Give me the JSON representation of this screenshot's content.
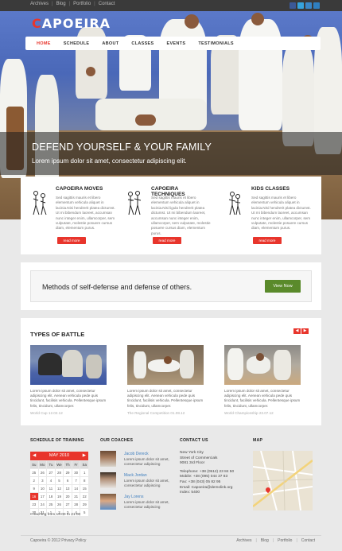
{
  "top_links": [
    "Archives",
    "Blog",
    "Portfolio",
    "Contact"
  ],
  "social": [
    {
      "icon": "facebook-icon",
      "color": "#3b5998"
    },
    {
      "icon": "twitter-icon",
      "color": "#36a3dd"
    },
    {
      "icon": "rss-icon",
      "color": "#3a87c7"
    },
    {
      "icon": "share-icon",
      "color": "#2f7fbf"
    }
  ],
  "logo": {
    "accent": "C",
    "rest": "APOEIRA"
  },
  "nav": [
    "HOME",
    "SCHEDULE",
    "ABOUT",
    "CLASSES",
    "EVENTS",
    "TESTIMONIALS"
  ],
  "hero": {
    "title": "DEFEND YOURSELF & YOUR FAMILY",
    "subtitle": "Lorem ipsum dolor sit amet, consectetur adipiscing elit."
  },
  "features": [
    {
      "title": "CAPOEIRA MOVES",
      "text": "Sed sagittis mauris et libero elementum vehicula aliquet in lacinia.Nisi hendrerit platea dictumst. Ut mi bibendum laoreet, accumsan nunc integer enim, ullamcorper, sem vulputate, molestie posuere cursus diam, elementum purus.",
      "button": "read more"
    },
    {
      "title": "CAPOEIRA TECHNIQUES",
      "text": "Sed sagittis mauris et libero elementum vehicula aliquet in lacinia.Nisi ligula hendrerit platea dictumst. Ut mi bibendum laoreet, accumsan nunc integer enim, ullamcorper, sem vulputate, molestie posuere cursus diam, elementum purus.",
      "button": "read more"
    },
    {
      "title": "KIDS CLASSES",
      "text": "Sed sagittis mauris et libero elementum vehicula aliquet in lacinia.Nisi hendrerit platea dictumst. Ut mi bibendum laoreet, accumsan nunc integer enim, ullamcorper, sem vulputate, molestie posuere cursus diam, elementum purus.",
      "button": "read more"
    }
  ],
  "cta": {
    "text": "Methods of self-defense and defense of others.",
    "button": "View Now"
  },
  "battle": {
    "title": "TYPES OF BATTLE",
    "prev": "◀",
    "next": "▶",
    "cards": [
      {
        "text": "Lorem ipsum dolor sit amet, consectetur adipiscing elit. Aenean vehicula pede quis tincidunt, facilisis vehicula. Pellentesque ipsum felis, tincidunt, ullamcorper.",
        "meta": "World Cup 12.02.12"
      },
      {
        "text": "Lorem ipsum dolor sit amet, consectetur adipiscing elit. Aenean vehicula pede quis tincidunt, facilisis vehicula. Pellentesque ipsum felis, tincidunt, ullamcorper.",
        "meta": "The Regional Competition 01.08.12"
      },
      {
        "text": "Lorem ipsum dolor sit amet, consectetur adipiscing elit. Aenean vehicula pede quis tincidunt, facilisis vehicula. Pellentesque ipsum felis, tincidunt, ullamcorper.",
        "meta": "World Championship 23.07.12"
      }
    ]
  },
  "footer": {
    "schedule_title": "SCHEDULE OF TRAINING",
    "calendar": {
      "month": "MAY 2010",
      "prev": "◀",
      "next": "▶",
      "weekdays": [
        "Su",
        "Mo",
        "Tu",
        "We",
        "Th",
        "Fr",
        "Sa"
      ],
      "days": [
        "25",
        "26",
        "27",
        "28",
        "29",
        "30",
        "1",
        "2",
        "3",
        "4",
        "5",
        "6",
        "7",
        "8",
        "9",
        "10",
        "11",
        "12",
        "13",
        "14",
        "15",
        "16",
        "17",
        "18",
        "19",
        "20",
        "21",
        "22",
        "23",
        "24",
        "25",
        "26",
        "27",
        "28",
        "29",
        "30",
        "31",
        "1",
        "2",
        "3",
        "4",
        "5"
      ],
      "today": "16"
    },
    "schedule_note": "Coaching from 18:00 to 21:00",
    "coaches_title": "OUR COACHES",
    "coaches": [
      {
        "name": "Jacob Dereck",
        "text": "Lorem ipsum dolor sit amet, consectetur adipiscing"
      },
      {
        "name": "Mack Jordan",
        "text": "Lorem ipsum dolor sit amet, consectetur adipiscing"
      },
      {
        "name": "Jay Lorens",
        "text": "Lorem ipsum dolor sit amet, consectetur adipiscing"
      }
    ],
    "contact_title": "CONTACT US",
    "contact_lines": [
      "New York City",
      "Street of Commercials",
      "9081 3rd Floor",
      "",
      "Telephone:  +38 (0512) 23 84 50",
      "Mobile:  +38 (095) 044 37 83",
      "Fax:  +38 (043) 05 82 95",
      "Email: Capoeira@demolink.org",
      "Index: 5400"
    ],
    "map_title": "MAP"
  },
  "bottom": {
    "copyright": "Capoeira © 2012 Privacy Policy",
    "links": [
      "Archives",
      "Blog",
      "Portfolio",
      "Contact"
    ]
  }
}
